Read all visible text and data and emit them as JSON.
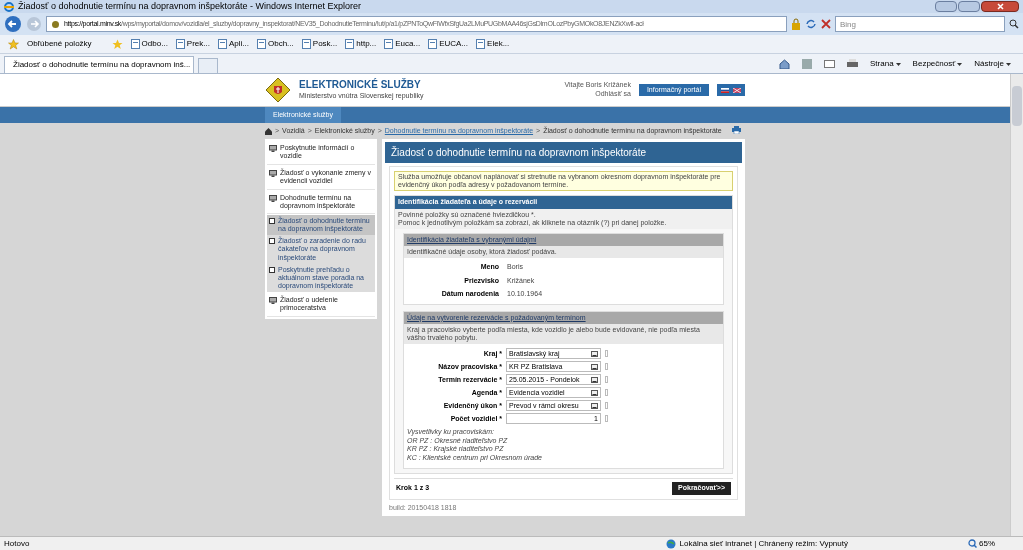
{
  "window": {
    "title": "Žiadosť o dohodnutie termínu na dopravnom inšpektoráte - Windows Internet Explorer"
  },
  "address_bar": {
    "url_host": "https://portal.minv.sk",
    "url_path": "/wps/myportal/domov/vozidla/el_sluzby/dopravny_inspektorat/NEV35_DohodnutieTerminu/!ut/p/a1/pZPNToQwFIWfxSfgUa2LMuPUGbMAA46sjGsDlmOLozPbyGMOkO8JENZkXwfl-acł"
  },
  "search": {
    "placeholder": "Bing"
  },
  "favorites_bar": {
    "label": "Obľúbené položky",
    "items": [
      "Odbo...",
      "Prek...",
      "Apli...",
      "Obch...",
      "Posk...",
      "http...",
      "Euca...",
      "EUCA...",
      "Elek..."
    ]
  },
  "tabs": [
    {
      "label": "Žiadosť o dohodnutie termínu na dopravnom inš...",
      "selected": true
    }
  ],
  "command_bar": [
    "Strana",
    "Bezpečnosť",
    "Nástroje"
  ],
  "site_header": {
    "title": "ELEKTRONICKÉ SLUŽBY",
    "subtitle": "Ministerstvo vnútra Slovenskej republiky",
    "welcome": "Vitajte Boris Križánek",
    "logout": "Odhlásiť sa",
    "portal_button": "Informačný portál"
  },
  "nav_bar": {
    "items": [
      {
        "label": "Elektronické služby",
        "selected": true
      }
    ]
  },
  "breadcrumb": [
    {
      "separator": ">",
      "label": "Vozidlá",
      "link": false
    },
    {
      "separator": ">",
      "label": "Elektronické služby",
      "link": false
    },
    {
      "separator": ">",
      "label": "Dohodnutie termínu na dopravnom inšpektoráte",
      "link": true
    },
    {
      "separator": ">",
      "label": "Žiadosť o dohodnutie termínu na dopravnom inšpektoráte",
      "link": false
    }
  ],
  "sidebar": {
    "items": [
      {
        "label": "Poskytnutie informácií o vozidle"
      },
      {
        "label": "Žiadosť o vykonanie zmeny v evidencii vozidiel"
      },
      {
        "label": "Dohodnutie termínu na dopravnom inšpektoráte",
        "children": [
          {
            "label": "Žiadosť o dohodnutie termínu na dopravnom inšpektoráte",
            "selected": true
          },
          {
            "label": "Žiadosť o zaradenie do radu čakateľov na dopravnom inšpektoráte",
            "selected": false
          },
          {
            "label": "Poskytnutie prehľadu o aktuálnom stave poradia na dopravnom inšpektoráte",
            "selected": false
          }
        ]
      },
      {
        "label": "Žiadosť o udelenie primoceratstva"
      }
    ]
  },
  "main": {
    "heading": "Žiadosť o dohodnutie termínu na dopravnom inšpektoráte",
    "info": "Služba umožňuje občanovi naplánovať si stretnutie na vybranom okresnom dopravnom inšpektoráte pre evidenčný úkon podľa adresy v požadovanom termíne.",
    "section_title": "Identifikácia žiadateľa a údaje o rezervácii",
    "section_notes": [
      "Povinné položky sú označené hviezdičkou *.",
      "Pomoc k jednotlivým položkám sa zobrazí, ak kliknete na otáznik (?) pri danej položke."
    ],
    "applicant": {
      "title": "Identifikácia žiadateľa s vybranými údajmi",
      "description": "Identifikačné údaje osoby, ktorá žiadosť podáva.",
      "fields": [
        {
          "label": "Meno",
          "value": "Boris"
        },
        {
          "label": "Priezvisko",
          "value": "Križánek"
        },
        {
          "label": "Dátum narodenia",
          "value": "10.10.1964"
        }
      ]
    },
    "reservation": {
      "title": "Údaje na vytvorenie rezervácie s požadovaným termínom",
      "description": "Kraj a pracovisko vyberte podľa miesta, kde vozidlo je alebo bude evidované, nie podľa miesta vášho trvalého pobytu.",
      "fields": [
        {
          "label": "Kraj *",
          "value": "Bratislavský kraj",
          "kind": "picker"
        },
        {
          "label": "Názov pracoviska *",
          "value": "KR PZ Bratislava",
          "kind": "picker"
        },
        {
          "label": "Termín rezervácie *",
          "value": "25.05.2015 - Pondelok",
          "kind": "picker"
        },
        {
          "label": "Agenda *",
          "value": "Evidencia vozidiel",
          "kind": "picker"
        },
        {
          "label": "Evidenčný úkon *",
          "value": "Prevod v rámci okresu",
          "kind": "picker"
        },
        {
          "label": "Počet vozidiel *",
          "value": "1",
          "kind": "number"
        }
      ],
      "legend": [
        "Vysvetlivky ku pracoviskám:",
        "OR PZ : Okresné riaditeľstvo PZ",
        "KR PZ : Krajské riaditeľstvo PZ",
        "KC : Klientské centrum pri Okresnom úrade"
      ]
    },
    "step": "Krok 1 z 3",
    "next_button": "Pokračovať>>",
    "build": "build: 20150418 1818"
  },
  "status_bar": {
    "status": "Hotovo",
    "zone": "Lokálna sieť intranet | Chránený režim: Vypnutý",
    "zoom": "65%"
  }
}
